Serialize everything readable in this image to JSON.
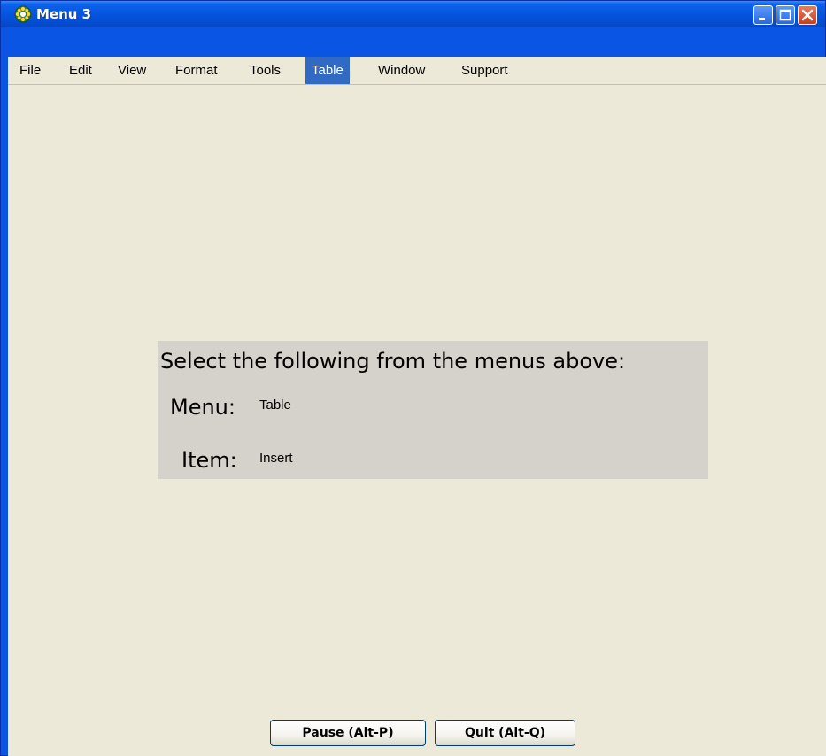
{
  "window": {
    "title": "Menu 3",
    "icon": "app-icon",
    "controls": [
      "minimize-icon",
      "maximize-icon",
      "close-icon"
    ]
  },
  "menubar": {
    "items": [
      {
        "label": "File"
      },
      {
        "label": "Edit"
      },
      {
        "label": "View"
      },
      {
        "label": "Format"
      },
      {
        "label": "Tools"
      },
      {
        "label": "Table",
        "active": true
      },
      {
        "label": "Window"
      },
      {
        "label": "Support"
      }
    ]
  },
  "instructions": {
    "heading": "Select the following from the menus above:",
    "menu_label": "Menu:",
    "menu_value": "Table",
    "item_label": "Item:",
    "item_value": "Insert"
  },
  "buttons": {
    "pause_label": "Pause (Alt-P)",
    "quit_label": "Quit (Alt-Q)"
  },
  "colors": {
    "titlebar": "#0a55e3",
    "menu_highlight": "#316ac5",
    "client_bg": "#ece9d8",
    "panel_bg": "#d5d1cb"
  }
}
